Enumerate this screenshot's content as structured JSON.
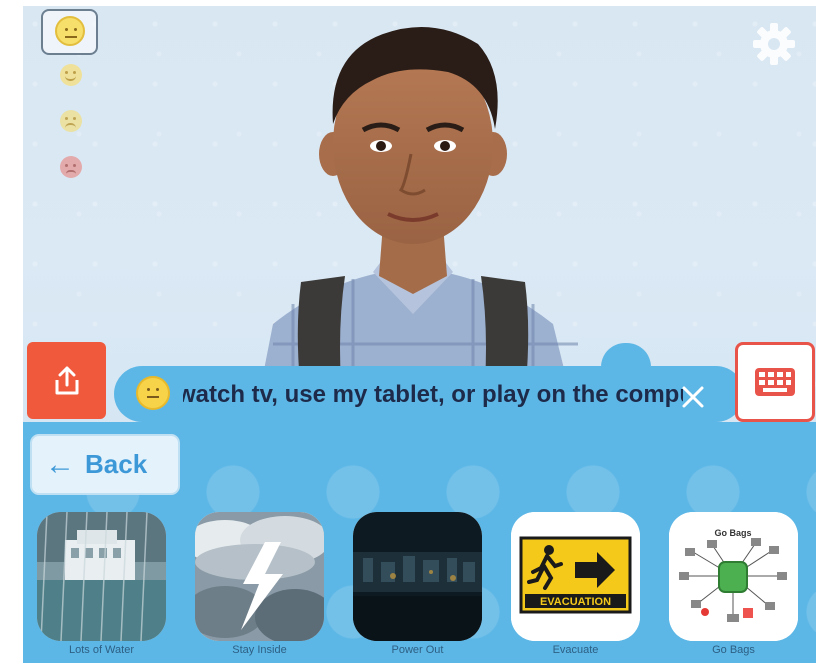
{
  "scene": {
    "moods": [
      "neutral-face",
      "happy-face",
      "sad-face",
      "angry-face"
    ],
    "selected_mood": "neutral-face"
  },
  "bubble": {
    "text": "watch tv, use my tablet, or play on the compu"
  },
  "back": {
    "label": "Back"
  },
  "tiles": [
    {
      "label": "Lots of Water",
      "icon": "flood-icon"
    },
    {
      "label": "Stay Inside",
      "icon": "storm-icon"
    },
    {
      "label": "Power Out",
      "icon": "power-out-icon"
    },
    {
      "label": "Evacuate",
      "icon": "evacuation-sign-icon",
      "sign_text": "EVACUATION"
    },
    {
      "label": "Go Bags",
      "icon": "go-bags-icon",
      "heading": "Go Bags"
    }
  ],
  "colors": {
    "accent": "#5db7e6",
    "share": "#f0593c",
    "keyboard": "#e9544a",
    "text": "#1e2a4a"
  }
}
